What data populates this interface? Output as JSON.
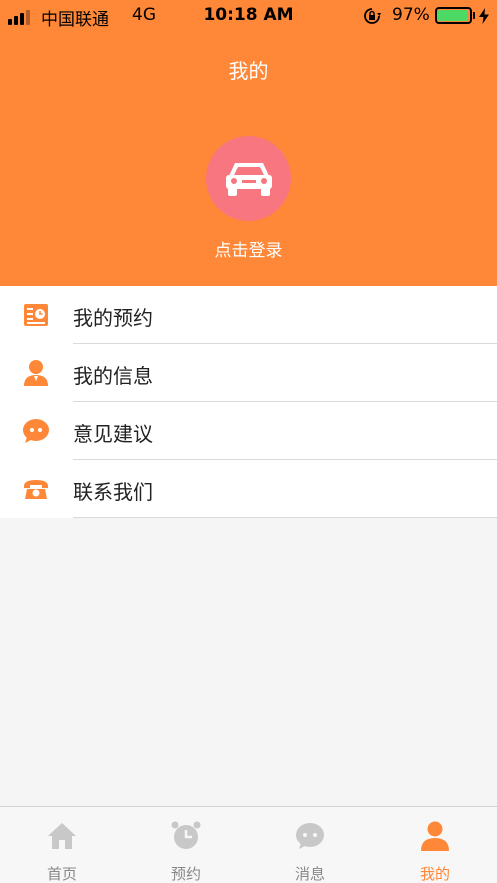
{
  "status_bar": {
    "carrier": "中国联通",
    "network": "4G",
    "time": "10:18 AM",
    "battery_percent": "97%",
    "battery_level": 0.97
  },
  "header": {
    "title": "我的",
    "login_text": "点击登录",
    "avatar_icon": "car-icon"
  },
  "menu": {
    "items": [
      {
        "label": "我的预约",
        "icon": "appointment-card-icon"
      },
      {
        "label": "我的信息",
        "icon": "person-icon"
      },
      {
        "label": "意见建议",
        "icon": "chat-bubble-icon"
      },
      {
        "label": "联系我们",
        "icon": "telephone-icon"
      }
    ]
  },
  "tabbar": {
    "tabs": [
      {
        "label": "首页",
        "icon": "home-icon",
        "active": false
      },
      {
        "label": "预约",
        "icon": "alarm-clock-icon",
        "active": false
      },
      {
        "label": "消息",
        "icon": "message-icon",
        "active": false
      },
      {
        "label": "我的",
        "icon": "person-icon",
        "active": true
      }
    ]
  },
  "colors": {
    "accent": "#fe8838",
    "avatar_bg": "#f8767f",
    "tab_inactive": "#c8c8c8"
  }
}
